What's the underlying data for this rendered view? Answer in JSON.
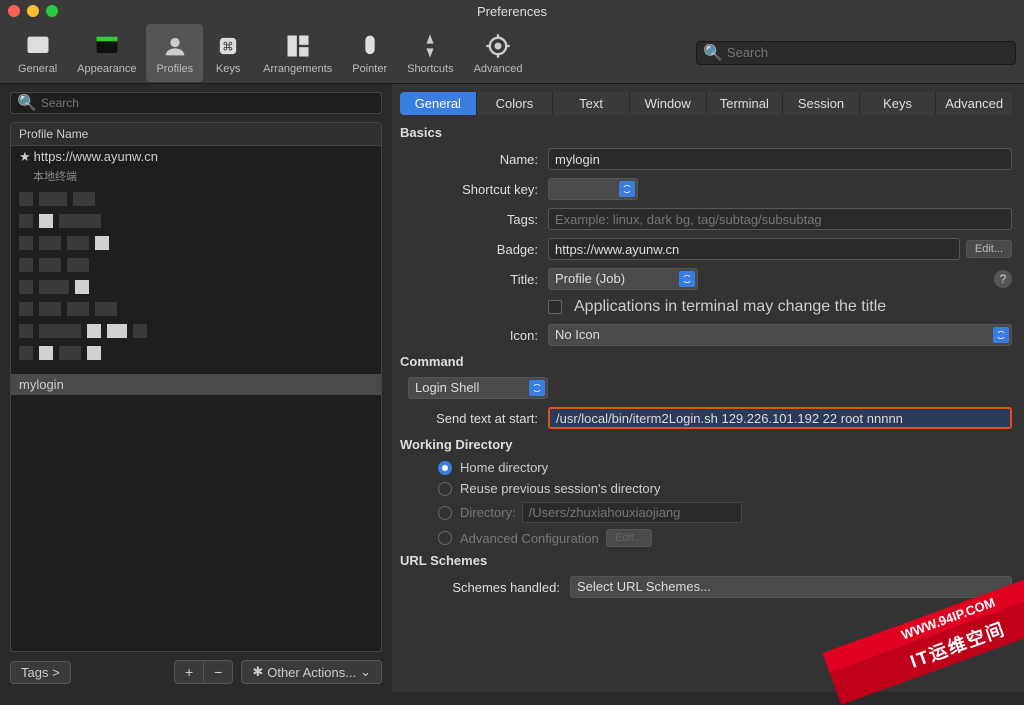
{
  "window": {
    "title": "Preferences"
  },
  "toolbar": {
    "items": [
      {
        "label": "General"
      },
      {
        "label": "Appearance"
      },
      {
        "label": "Profiles"
      },
      {
        "label": "Keys"
      },
      {
        "label": "Arrangements"
      },
      {
        "label": "Pointer"
      },
      {
        "label": "Shortcuts"
      },
      {
        "label": "Advanced"
      }
    ],
    "search_placeholder": "Search"
  },
  "left": {
    "search_placeholder": "Search",
    "header": "Profile Name",
    "profiles": [
      {
        "name": "https://www.ayunw.cn",
        "sub": "本地终端",
        "default": true
      },
      {
        "name": "mylogin",
        "sub": "",
        "default": false
      }
    ],
    "tags_label": "Tags >",
    "add": "+",
    "remove": "−",
    "other_actions": "Other Actions..."
  },
  "right": {
    "tabs": [
      "General",
      "Colors",
      "Text",
      "Window",
      "Terminal",
      "Session",
      "Keys",
      "Advanced"
    ],
    "basics": {
      "heading": "Basics",
      "name_label": "Name:",
      "name_value": "mylogin",
      "shortcut_label": "Shortcut key:",
      "tags_label": "Tags:",
      "tags_placeholder": "Example: linux, dark bg, tag/subtag/subsubtag",
      "badge_label": "Badge:",
      "badge_value": "https://www.ayunw.cn",
      "edit": "Edit...",
      "title_label": "Title:",
      "title_value": "Profile (Job)",
      "apps_change": "Applications in terminal may change the title",
      "icon_label": "Icon:",
      "icon_value": "No Icon"
    },
    "command": {
      "heading": "Command",
      "shell_value": "Login Shell",
      "send_label": "Send text at start:",
      "send_value": "/usr/local/bin/iterm2Login.sh 129.226.101.192 22 root nnnnn"
    },
    "workdir": {
      "heading": "Working Directory",
      "home": "Home directory",
      "reuse": "Reuse previous session's directory",
      "dir_label": "Directory:",
      "dir_placeholder": "/Users/zhuxiahouxiaojiang",
      "advanced": "Advanced Configuration",
      "edit": "Edit..."
    },
    "url": {
      "heading": "URL Schemes",
      "label": "Schemes handled:",
      "value": "Select URL Schemes..."
    }
  },
  "watermark": {
    "top": "WWW.94IP.COM",
    "bottom": "IT运维空间"
  }
}
